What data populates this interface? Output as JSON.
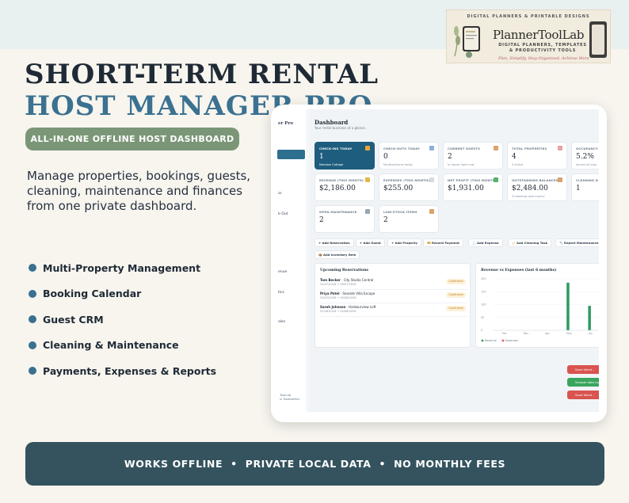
{
  "logo": {
    "top_text": "DIGITAL PLANNERS & PRINTABLE DESIGNS",
    "brand": "PlannerToolLab",
    "subtitle": "DIGITAL PLANNERS, TEMPLATES & PRODUCTIVITY TOOLS",
    "tagline": "Plan, Simplify, Stay Organized, Achieve More"
  },
  "hero": {
    "title_line1": "SHORT-TERM RENTAL",
    "title_line2": "HOST MANAGER PRO",
    "pill": "ALL-IN-ONE OFFLINE HOST DASHBOARD",
    "description": "Manage properties, bookings, guests, cleaning, maintenance and finances from one private dashboard.",
    "features": [
      "Multi-Property Management",
      "Booking Calendar",
      "Guest CRM",
      "Cleaning & Maintenance",
      "Payments, Expenses & Reports"
    ]
  },
  "banner": {
    "item1": "WORKS OFFLINE",
    "sep": "•",
    "item2": "PRIVATE LOCAL DATA",
    "item3": "NO MONTHLY FEES"
  },
  "app": {
    "sidebar": {
      "brand": "er Pro",
      "items": [
        "ar",
        "k-Out",
        "enue",
        "tics",
        "ales"
      ],
      "footer_line1": "ToolLab",
      "footer_line2": "sr Newsletter"
    },
    "dashboard": {
      "title": "Dashboard",
      "subtitle": "Your rental business at a glance."
    },
    "cards": [
      {
        "label": "CHECK-INS TODAY",
        "value": "1",
        "sub": "Meadow Cottage",
        "active": true,
        "icon": "suitcase-icon",
        "color": "#e7a53a"
      },
      {
        "label": "CHECK-OUTS TODAY",
        "value": "0",
        "sub": "No departures today",
        "icon": "broom-icon",
        "color": "#8fb0d8"
      },
      {
        "label": "CURRENT GUESTS",
        "value": "2",
        "sub": "In-house right now",
        "icon": "people-icon",
        "color": "#d9a36a"
      },
      {
        "label": "TOTAL PROPERTIES",
        "value": "4",
        "sub": "4 active",
        "icon": "house-icon",
        "color": "#e6a3a3"
      },
      {
        "label": "OCCUPANCY",
        "value": "5.2%",
        "sub": "Across all prop",
        "icon": "chart-icon",
        "color": "#cccccc"
      },
      {
        "label": "REVENUE (THIS MONTH)",
        "value": "$2,186.00",
        "sub": "",
        "icon": "money-icon",
        "color": "#e0b84a"
      },
      {
        "label": "EXPENSES (THIS MONTH)",
        "value": "$255.00",
        "sub": "",
        "icon": "receipt-icon",
        "color": "#d4dbe3"
      },
      {
        "label": "NET PROFIT (THIS MONTH)",
        "value": "$1,931.00",
        "sub": "",
        "icon": "check-icon",
        "color": "#52b26b"
      },
      {
        "label": "OUTSTANDING BALANCES",
        "value": "$2,484.00",
        "sub": "3 bookings owe money",
        "icon": "hourglass-icon",
        "color": "#d9a36a"
      },
      {
        "label": "CLEANING D",
        "value": "1",
        "sub": "",
        "icon": "",
        "color": "#cccccc"
      },
      {
        "label": "OPEN MAINTENANCE",
        "value": "2",
        "sub": "",
        "icon": "wrench-icon",
        "color": "#9aa6b2"
      },
      {
        "label": "LOW-STOCK ITEMS",
        "value": "2",
        "sub": "",
        "icon": "box-icon",
        "color": "#d9a36a"
      }
    ],
    "actions": [
      "+ Add Reservation",
      "+ Add Guest",
      "+ Add Property",
      "💳 Record Payment",
      "🧾 Add Expense",
      "🧹 Add Cleaning Task",
      "🔧 Report Maintenance",
      "📦 Add Inventory Item"
    ],
    "reservations": {
      "title": "Upcoming Reservations",
      "rows": [
        {
          "guest": "Tom Becker",
          "property": " · City Studio Central",
          "dates": "25/07/2026 → 26/07/2026",
          "status": "Confirmed"
        },
        {
          "guest": "Priya Patel",
          "property": " · Seaside Villa Escape",
          "dates": "29/07/2026 → 05/08/2026",
          "status": "Confirmed"
        },
        {
          "guest": "Sarah Johnson",
          "property": " · Harbourview Loft",
          "dates": "01/08/2026 → 04/08/2026",
          "status": "Confirmed"
        }
      ]
    },
    "toasts": [
      "Save failed –",
      "Sample data loa",
      "Save failed –"
    ]
  },
  "chart_data": {
    "type": "bar",
    "title": "Revenue vs Expenses (last 6 months)",
    "categories": [
      "Feb",
      "Mar",
      "Apr",
      "May",
      "Jun"
    ],
    "yticks": [
      "200",
      "150",
      "100",
      "50",
      "0"
    ],
    "ylim": [
      0,
      2000
    ],
    "series": [
      {
        "name": "Revenue",
        "color": "#2f9a63",
        "values": [
          0,
          0,
          0,
          1850,
          950
        ]
      },
      {
        "name": "Expenses",
        "color": "#e15b5b",
        "values": [
          0,
          0,
          0,
          0,
          0
        ]
      }
    ],
    "legend": "bottom-left"
  }
}
